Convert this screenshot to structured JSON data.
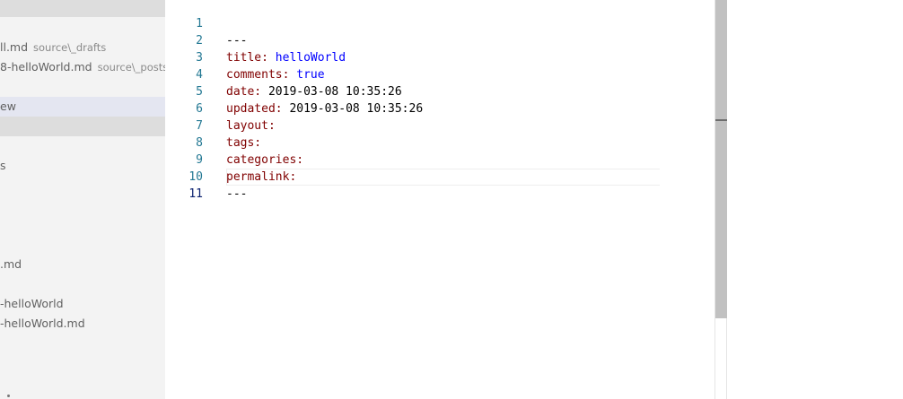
{
  "sidebar": {
    "rows": [
      {
        "name": "ll.md",
        "desc": "source\\_drafts"
      },
      {
        "name": "8-helloWorld.md",
        "desc": "source\\_posts"
      },
      {
        "name": "ew",
        "desc": ""
      },
      {
        "name": "s",
        "desc": ""
      },
      {
        "name": ".md",
        "desc": ""
      },
      {
        "name": "-helloWorld",
        "desc": ""
      },
      {
        "name": "-helloWorld.md",
        "desc": ""
      }
    ]
  },
  "editor": {
    "lines": [
      {
        "num": "1",
        "key": "---",
        "val": ""
      },
      {
        "num": "2",
        "key": "title:",
        "val": " helloWorld"
      },
      {
        "num": "3",
        "key": "comments:",
        "val": " true"
      },
      {
        "num": "4",
        "key": "date:",
        "val": " 2019-03-08 10:35:26"
      },
      {
        "num": "5",
        "key": "updated:",
        "val": " 2019-03-08 10:35:26"
      },
      {
        "num": "6",
        "key": "layout:",
        "val": ""
      },
      {
        "num": "7",
        "key": "tags:",
        "val": ""
      },
      {
        "num": "8",
        "key": "categories:",
        "val": ""
      },
      {
        "num": "9",
        "key": "permalink:",
        "val": ""
      },
      {
        "num": "10",
        "key": "---",
        "val": ""
      },
      {
        "num": "11",
        "key": "",
        "val": ""
      }
    ]
  },
  "colors": {
    "line_number": "#237893",
    "yaml_key": "#800000",
    "yaml_value_string": "#0000ff",
    "sidebar_bg": "#f3f3f3",
    "sidebar_selected": "#e4e6f1"
  }
}
